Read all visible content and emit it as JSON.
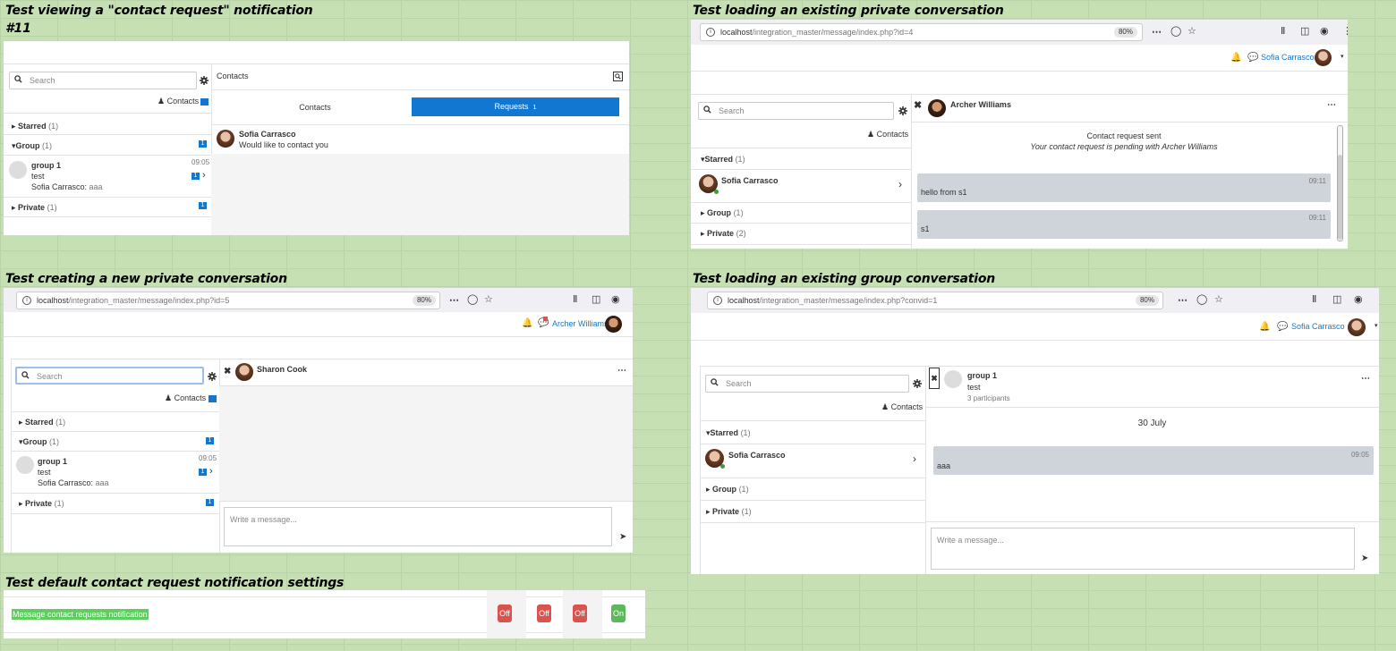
{
  "headings": {
    "h1": "Test viewing a \"contact request\" notification",
    "h1b": "#11",
    "h2": "Test loading an existing private conversation",
    "h3": "Test creating a new private conversation",
    "h4": "Test loading an existing group conversation",
    "h5": "Test default contact request notification settings"
  },
  "common": {
    "search_placeholder": "Search",
    "contacts": "Contacts",
    "starred": "Starred",
    "group": "Group",
    "private": "Private",
    "write_placeholder": "Write a message...",
    "count_1": "(1)",
    "count_2": "(2)",
    "badge_1": "1"
  },
  "p1": {
    "header_title": "Contacts",
    "tab_contacts": "Contacts",
    "tab_requests": "Requests",
    "requests_count": "1",
    "group_name": "group 1",
    "group_sub": "test",
    "group_last_sender": "Sofia Carrasco:",
    "group_last_msg": "aaa",
    "group_time": "09:05",
    "request_name": "Sofia Carrasco",
    "request_text": "Would like to contact you"
  },
  "p2": {
    "url_host": "localhost",
    "url_path": "/integration_master/message/index.php?id=4",
    "zoom": "80%",
    "user": "Sofia Carrasco",
    "conv_name": "Archer Williams",
    "notice_title": "Contact request sent",
    "notice_text": "Your contact request is pending with Archer Williams",
    "starred_name": "Sofia Carrasco",
    "msg1": "hello from s1",
    "msg1_time": "09:11",
    "msg2": "s1",
    "msg2_time": "09:11"
  },
  "p3": {
    "url_host": "localhost",
    "url_path": "/integration_master/message/index.php?id=5",
    "zoom": "80%",
    "user": "Archer Williams",
    "conv_name": "Sharon Cook",
    "group_name": "group 1",
    "group_sub": "test",
    "group_last_sender": "Sofia Carrasco:",
    "group_last_msg": "aaa",
    "group_time": "09:05"
  },
  "p4": {
    "url_host": "localhost",
    "url_path": "/integration_master/message/index.php?convid=1",
    "zoom": "80%",
    "user": "Sofia Carrasco",
    "conv_name": "group 1",
    "conv_sub": "test",
    "participants": "3 participants",
    "date": "30 July",
    "starred_name": "Sofia Carrasco",
    "msg1": "aaa",
    "msg1_time": "09:05"
  },
  "p5": {
    "label": "Message contact requests notification",
    "toggles": [
      "Off",
      "Off",
      "Off",
      "On"
    ]
  }
}
